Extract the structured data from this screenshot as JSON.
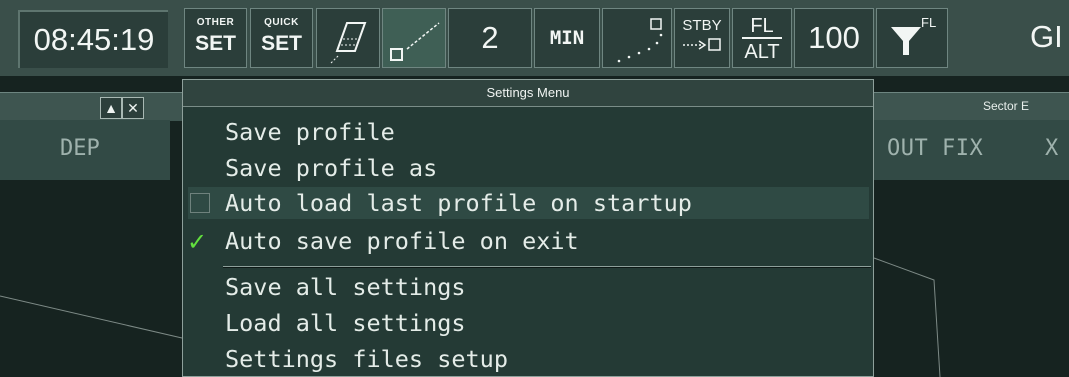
{
  "toolbar": {
    "clock": "08:45:19",
    "other_set": {
      "small": "OTHER",
      "big": "SET"
    },
    "quick_set": {
      "small": "QUICK",
      "big": "SET"
    },
    "count": "2",
    "min_label": "MIN",
    "stby_label": "STBY",
    "fl_label": "FL",
    "alt_label": "ALT",
    "level_value": "100",
    "filter_sup": "FL",
    "gi_fragment": "GI"
  },
  "left_window": {
    "column": "DEP"
  },
  "right_window": {
    "title_fragment": "Sector E",
    "column_outfix": "OUT FIX",
    "column_x": "X"
  },
  "settings_menu": {
    "title": "Settings Menu",
    "items": [
      {
        "label": "Save profile"
      },
      {
        "label": "Save profile as"
      },
      {
        "label": "Auto load last profile on startup",
        "checked": false
      },
      {
        "label": "Auto save profile on exit",
        "checked": true
      },
      {
        "label": "Save all settings"
      },
      {
        "label": "Load all settings"
      },
      {
        "label": "Settings files setup"
      }
    ]
  },
  "colors": {
    "background": "#162320",
    "toolbar": "#3a4f4a",
    "menu_bg": "#243a35",
    "check_green": "#62e03e"
  }
}
